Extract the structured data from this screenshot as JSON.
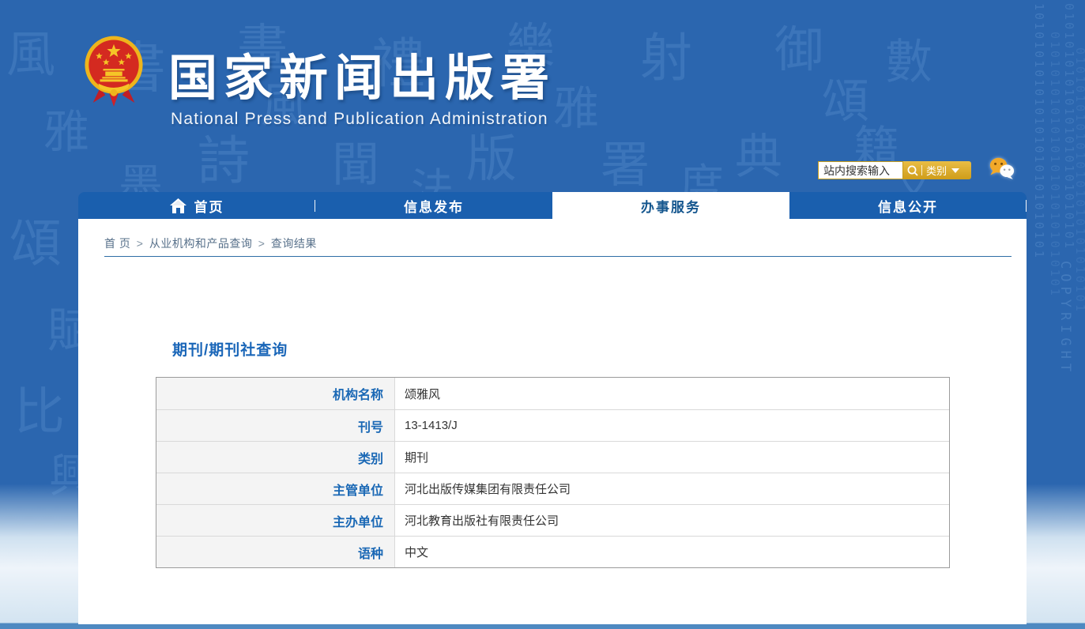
{
  "header": {
    "title": "国家新闻出版署",
    "subtitle": "National  Press and Publication Administration"
  },
  "search": {
    "placeholder": "站内搜索输入",
    "category_label": "类别"
  },
  "nav": {
    "items": [
      {
        "label": "首页"
      },
      {
        "label": "信息发布"
      },
      {
        "label": "办事服务"
      },
      {
        "label": "信息公开"
      }
    ]
  },
  "breadcrumb": {
    "items": [
      "首 页",
      "从业机构和产品查询",
      "查询结果"
    ],
    "separator": ">"
  },
  "main": {
    "section_title": "期刊/期刊社查询",
    "table": {
      "rows": [
        {
          "label": "机构名称",
          "value": "颂雅风"
        },
        {
          "label": "刊号",
          "value": "13-1413/J"
        },
        {
          "label": "类别",
          "value": "期刊"
        },
        {
          "label": "主管单位",
          "value": "河北出版传媒集团有限责任公司"
        },
        {
          "label": "主办单位",
          "value": "河北教育出版社有限责任公司"
        },
        {
          "label": "语种",
          "value": "中文"
        }
      ]
    }
  },
  "colors": {
    "background_blue": "#2b66af",
    "nav_blue": "#1a5fae",
    "accent_gold": "#d2a42b",
    "label_blue": "#1a68b5",
    "active_tab_text": "#14568e"
  },
  "decor": {
    "calligraphy_chars": "風雅頌賦比興書畫禮樂射御數詩聞版署典籍墨法度文",
    "binary_column": "0101010101010101010101010101",
    "copyright_text": "COPYRIGHT"
  }
}
